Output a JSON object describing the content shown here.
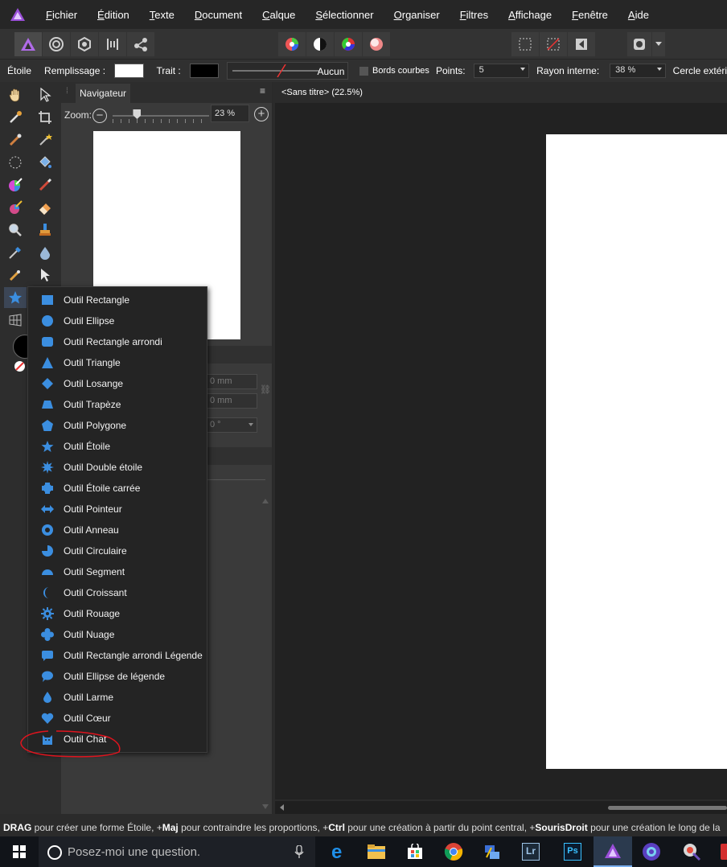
{
  "menu": [
    "Fichier",
    "Édition",
    "Texte",
    "Document",
    "Calque",
    "Sélectionner",
    "Organiser",
    "Filtres",
    "Affichage",
    "Fenêtre",
    "Aide"
  ],
  "context": {
    "tool_name": "Étoile",
    "fill_label": "Remplissage :",
    "stroke_label": "Trait :",
    "stroke_value": "Aucun",
    "rounded_label": "Bords courbes",
    "points_label": "Points:",
    "points_value": "5",
    "inner_radius_label": "Rayon interne:",
    "inner_radius_value": "38 %",
    "outer_circle_label": "Cercle extéri"
  },
  "panel": {
    "tab_label": "Navigateur",
    "zoom_label": "Zoom:",
    "zoom_value": "23 %",
    "zoom_level": 0.23,
    "field_w": "0 mm",
    "field_h": "0 mm",
    "field_angle": "0 °"
  },
  "document": {
    "title": "<Sans titre> (22.5%)"
  },
  "flyout": {
    "items": [
      {
        "label": "Outil Rectangle",
        "icon": "rectangle-icon"
      },
      {
        "label": "Outil Ellipse",
        "icon": "ellipse-icon"
      },
      {
        "label": "Outil Rectangle arrondi",
        "icon": "rounded-rectangle-icon"
      },
      {
        "label": "Outil Triangle",
        "icon": "triangle-icon"
      },
      {
        "label": "Outil Losange",
        "icon": "diamond-icon"
      },
      {
        "label": "Outil Trapèze",
        "icon": "trapezoid-icon"
      },
      {
        "label": "Outil Polygone",
        "icon": "polygon-icon"
      },
      {
        "label": "Outil Étoile",
        "icon": "star-icon"
      },
      {
        "label": "Outil Double étoile",
        "icon": "double-star-icon"
      },
      {
        "label": "Outil Étoile carrée",
        "icon": "square-star-icon"
      },
      {
        "label": "Outil Pointeur",
        "icon": "double-arrow-icon"
      },
      {
        "label": "Outil Anneau",
        "icon": "donut-icon"
      },
      {
        "label": "Outil Circulaire",
        "icon": "pie-icon"
      },
      {
        "label": "Outil Segment",
        "icon": "segment-icon"
      },
      {
        "label": "Outil Croissant",
        "icon": "crescent-icon"
      },
      {
        "label": "Outil Rouage",
        "icon": "cog-icon"
      },
      {
        "label": "Outil Nuage",
        "icon": "cloud-icon"
      },
      {
        "label": "Outil Rectangle arrondi Légende",
        "icon": "callout-rectangle-icon"
      },
      {
        "label": "Outil Ellipse de légende",
        "icon": "callout-ellipse-icon"
      },
      {
        "label": "Outil Larme",
        "icon": "teardrop-icon"
      },
      {
        "label": "Outil Cœur",
        "icon": "heart-icon"
      },
      {
        "label": "Outil Chat",
        "icon": "cat-icon"
      }
    ]
  },
  "status": {
    "k1": "DRAG",
    "t1": " pour créer une forme Étoile, +",
    "k2": "Maj",
    "t2": " pour contraindre les proportions, +",
    "k3": "Ctrl",
    "t3": " pour une création à partir du point central, +",
    "k4": "SourisDroit",
    "t4": " pour une création le long de la"
  },
  "taskbar": {
    "search_placeholder": "Posez-moi une question.",
    "lr_label": "Lr",
    "ps_label": "Ps"
  },
  "colors": {
    "accent_blue": "#3b8ee0",
    "annotation_red": "#e0141e",
    "background": "#2b2b2b"
  }
}
